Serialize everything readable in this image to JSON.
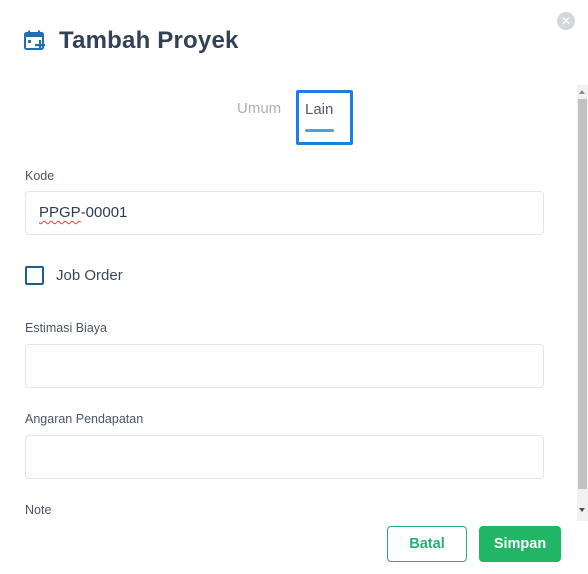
{
  "dialog": {
    "title": "Tambah Proyek",
    "title_icon": "calendar-add-icon",
    "close_icon": "close-icon"
  },
  "tabs": [
    {
      "label": "Umum",
      "active": false
    },
    {
      "label": "Lain",
      "active": true
    }
  ],
  "form": {
    "kode": {
      "label": "Kode",
      "value_prefix": "PPGP",
      "value_suffix": "-00001"
    },
    "job_order": {
      "label": "Job Order",
      "checked": false
    },
    "estimasi_biaya": {
      "label": "Estimasi Biaya",
      "value": ""
    },
    "angaran_pendapatan": {
      "label": "Angaran Pendapatan",
      "value": ""
    },
    "note": {
      "label": "Note"
    }
  },
  "actions": {
    "cancel_label": "Batal",
    "save_label": "Simpan"
  },
  "colors": {
    "primary": "#21b566",
    "tab_focus": "#1a7fe0",
    "tab_underline": "#4aa3d8",
    "title": "#334157",
    "checkbox_border": "#1d5f8c"
  }
}
